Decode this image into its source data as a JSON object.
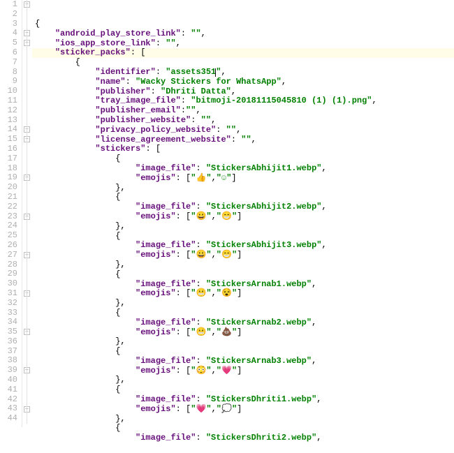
{
  "editor": {
    "highlighted_line": 6,
    "cursor_line": 6,
    "lines": [
      {
        "n": 1,
        "indent": 0,
        "tokens": [
          [
            "punc",
            "{"
          ]
        ]
      },
      {
        "n": 2,
        "indent": 1,
        "tokens": [
          [
            "key",
            "\"android_play_store_link\""
          ],
          [
            "punc",
            ": "
          ],
          [
            "str",
            "\"\""
          ],
          [
            "punc",
            ","
          ]
        ]
      },
      {
        "n": 3,
        "indent": 1,
        "tokens": [
          [
            "key",
            "\"ios_app_store_link\""
          ],
          [
            "punc",
            ": "
          ],
          [
            "str",
            "\"\""
          ],
          [
            "punc",
            ","
          ]
        ]
      },
      {
        "n": 4,
        "indent": 1,
        "tokens": [
          [
            "key",
            "\"sticker_packs\""
          ],
          [
            "punc",
            ": ["
          ]
        ]
      },
      {
        "n": 5,
        "indent": 2,
        "tokens": [
          [
            "punc",
            "{"
          ]
        ]
      },
      {
        "n": 6,
        "indent": 3,
        "tokens": [
          [
            "key",
            "\"identifier\""
          ],
          [
            "punc",
            ": "
          ],
          [
            "str",
            "\"assets351"
          ],
          [
            "cursor",
            ""
          ],
          [
            "str",
            "\""
          ],
          [
            "punc",
            ","
          ]
        ]
      },
      {
        "n": 7,
        "indent": 3,
        "tokens": [
          [
            "key",
            "\"name\""
          ],
          [
            "punc",
            ": "
          ],
          [
            "str",
            "\"Wacky Stickers for WhatsApp\""
          ],
          [
            "punc",
            ","
          ]
        ]
      },
      {
        "n": 8,
        "indent": 3,
        "tokens": [
          [
            "key",
            "\"publisher\""
          ],
          [
            "punc",
            ": "
          ],
          [
            "str",
            "\"Dhriti Datta\""
          ],
          [
            "punc",
            ","
          ]
        ]
      },
      {
        "n": 9,
        "indent": 3,
        "tokens": [
          [
            "key",
            "\"tray_image_file\""
          ],
          [
            "punc",
            ": "
          ],
          [
            "str",
            "\"bitmoji-20181115045810 (1) (1).png\""
          ],
          [
            "punc",
            ","
          ]
        ]
      },
      {
        "n": 10,
        "indent": 3,
        "tokens": [
          [
            "key",
            "\"publisher_email\""
          ],
          [
            "punc",
            ":"
          ],
          [
            "str",
            "\"\""
          ],
          [
            "punc",
            ","
          ]
        ]
      },
      {
        "n": 11,
        "indent": 3,
        "tokens": [
          [
            "key",
            "\"publisher_website\""
          ],
          [
            "punc",
            ": "
          ],
          [
            "str",
            "\"\""
          ],
          [
            "punc",
            ","
          ]
        ]
      },
      {
        "n": 12,
        "indent": 3,
        "tokens": [
          [
            "key",
            "\"privacy_policy_website\""
          ],
          [
            "punc",
            ": "
          ],
          [
            "str",
            "\"\""
          ],
          [
            "punc",
            ","
          ]
        ]
      },
      {
        "n": 13,
        "indent": 3,
        "tokens": [
          [
            "key",
            "\"license_agreement_website\""
          ],
          [
            "punc",
            ": "
          ],
          [
            "str",
            "\"\""
          ],
          [
            "punc",
            ","
          ]
        ]
      },
      {
        "n": 14,
        "indent": 3,
        "tokens": [
          [
            "key",
            "\"stickers\""
          ],
          [
            "punc",
            ": ["
          ]
        ]
      },
      {
        "n": 15,
        "indent": 4,
        "tokens": [
          [
            "punc",
            "{"
          ]
        ]
      },
      {
        "n": 16,
        "indent": 5,
        "tokens": [
          [
            "key",
            "\"image_file\""
          ],
          [
            "punc",
            ": "
          ],
          [
            "str",
            "\"StickersAbhijit1.webp\""
          ],
          [
            "punc",
            ","
          ]
        ]
      },
      {
        "n": 17,
        "indent": 5,
        "tokens": [
          [
            "key",
            "\"emojis\""
          ],
          [
            "punc",
            ": ["
          ],
          [
            "str",
            "\"👍\""
          ],
          [
            "punc",
            ","
          ],
          [
            "str",
            "\"☺\""
          ],
          [
            "punc",
            "]"
          ]
        ]
      },
      {
        "n": 18,
        "indent": 4,
        "tokens": [
          [
            "punc",
            "},"
          ]
        ]
      },
      {
        "n": 19,
        "indent": 4,
        "tokens": [
          [
            "punc",
            "{"
          ]
        ]
      },
      {
        "n": 20,
        "indent": 5,
        "tokens": [
          [
            "key",
            "\"image_file\""
          ],
          [
            "punc",
            ": "
          ],
          [
            "str",
            "\"StickersAbhijit2.webp\""
          ],
          [
            "punc",
            ","
          ]
        ]
      },
      {
        "n": 21,
        "indent": 5,
        "tokens": [
          [
            "key",
            "\"emojis\""
          ],
          [
            "punc",
            ": ["
          ],
          [
            "str",
            "\"😀\""
          ],
          [
            "punc",
            ","
          ],
          [
            "str",
            "\"😁\""
          ],
          [
            "punc",
            "]"
          ]
        ]
      },
      {
        "n": 22,
        "indent": 4,
        "tokens": [
          [
            "punc",
            "},"
          ]
        ]
      },
      {
        "n": 23,
        "indent": 4,
        "tokens": [
          [
            "punc",
            "{"
          ]
        ]
      },
      {
        "n": 24,
        "indent": 5,
        "tokens": [
          [
            "key",
            "\"image_file\""
          ],
          [
            "punc",
            ": "
          ],
          [
            "str",
            "\"StickersAbhijit3.webp\""
          ],
          [
            "punc",
            ","
          ]
        ]
      },
      {
        "n": 25,
        "indent": 5,
        "tokens": [
          [
            "key",
            "\"emojis\""
          ],
          [
            "punc",
            ": ["
          ],
          [
            "str",
            "\"😀\""
          ],
          [
            "punc",
            ","
          ],
          [
            "str",
            "\"😁\""
          ],
          [
            "punc",
            "]"
          ]
        ]
      },
      {
        "n": 26,
        "indent": 4,
        "tokens": [
          [
            "punc",
            "},"
          ]
        ]
      },
      {
        "n": 27,
        "indent": 4,
        "tokens": [
          [
            "punc",
            "{"
          ]
        ]
      },
      {
        "n": 28,
        "indent": 5,
        "tokens": [
          [
            "key",
            "\"image_file\""
          ],
          [
            "punc",
            ": "
          ],
          [
            "str",
            "\"StickersArnab1.webp\""
          ],
          [
            "punc",
            ","
          ]
        ]
      },
      {
        "n": 29,
        "indent": 5,
        "tokens": [
          [
            "key",
            "\"emojis\""
          ],
          [
            "punc",
            ": ["
          ],
          [
            "str",
            "\"😬\""
          ],
          [
            "punc",
            ","
          ],
          [
            "str",
            "\"😵\""
          ],
          [
            "punc",
            "]"
          ]
        ]
      },
      {
        "n": 30,
        "indent": 4,
        "tokens": [
          [
            "punc",
            "},"
          ]
        ]
      },
      {
        "n": 31,
        "indent": 4,
        "tokens": [
          [
            "punc",
            "{"
          ]
        ]
      },
      {
        "n": 32,
        "indent": 5,
        "tokens": [
          [
            "key",
            "\"image_file\""
          ],
          [
            "punc",
            ": "
          ],
          [
            "str",
            "\"StickersArnab2.webp\""
          ],
          [
            "punc",
            ","
          ]
        ]
      },
      {
        "n": 33,
        "indent": 5,
        "tokens": [
          [
            "key",
            "\"emojis\""
          ],
          [
            "punc",
            ": ["
          ],
          [
            "str",
            "\"😬\""
          ],
          [
            "punc",
            ","
          ],
          [
            "str",
            "\"💩\""
          ],
          [
            "punc",
            "]"
          ]
        ]
      },
      {
        "n": 34,
        "indent": 4,
        "tokens": [
          [
            "punc",
            "},"
          ]
        ]
      },
      {
        "n": 35,
        "indent": 4,
        "tokens": [
          [
            "punc",
            "{"
          ]
        ]
      },
      {
        "n": 36,
        "indent": 5,
        "tokens": [
          [
            "key",
            "\"image_file\""
          ],
          [
            "punc",
            ": "
          ],
          [
            "str",
            "\"StickersArnab3.webp\""
          ],
          [
            "punc",
            ","
          ]
        ]
      },
      {
        "n": 37,
        "indent": 5,
        "tokens": [
          [
            "key",
            "\"emojis\""
          ],
          [
            "punc",
            ": ["
          ],
          [
            "str",
            "\"😳\""
          ],
          [
            "punc",
            ","
          ],
          [
            "str",
            "\"💗\""
          ],
          [
            "punc",
            "]"
          ]
        ]
      },
      {
        "n": 38,
        "indent": 4,
        "tokens": [
          [
            "punc",
            "},"
          ]
        ]
      },
      {
        "n": 39,
        "indent": 4,
        "tokens": [
          [
            "punc",
            "{"
          ]
        ]
      },
      {
        "n": 40,
        "indent": 5,
        "tokens": [
          [
            "key",
            "\"image_file\""
          ],
          [
            "punc",
            ": "
          ],
          [
            "str",
            "\"StickersDhriti1.webp\""
          ],
          [
            "punc",
            ","
          ]
        ]
      },
      {
        "n": 41,
        "indent": 5,
        "tokens": [
          [
            "key",
            "\"emojis\""
          ],
          [
            "punc",
            ": ["
          ],
          [
            "str",
            "\"💗\""
          ],
          [
            "punc",
            ","
          ],
          [
            "str",
            "\"💭\""
          ],
          [
            "punc",
            "]"
          ]
        ]
      },
      {
        "n": 42,
        "indent": 4,
        "tokens": [
          [
            "punc",
            "},"
          ]
        ]
      },
      {
        "n": 43,
        "indent": 4,
        "tokens": [
          [
            "punc",
            "{"
          ]
        ]
      },
      {
        "n": 44,
        "indent": 5,
        "tokens": [
          [
            "key",
            "\"image_file\""
          ],
          [
            "punc",
            ": "
          ],
          [
            "str",
            "\"StickersDhriti2.webp\""
          ],
          [
            "punc",
            ","
          ]
        ]
      }
    ],
    "fold_markers": [
      1,
      4,
      5,
      14,
      15,
      19,
      23,
      27,
      31,
      35,
      39,
      43
    ]
  }
}
